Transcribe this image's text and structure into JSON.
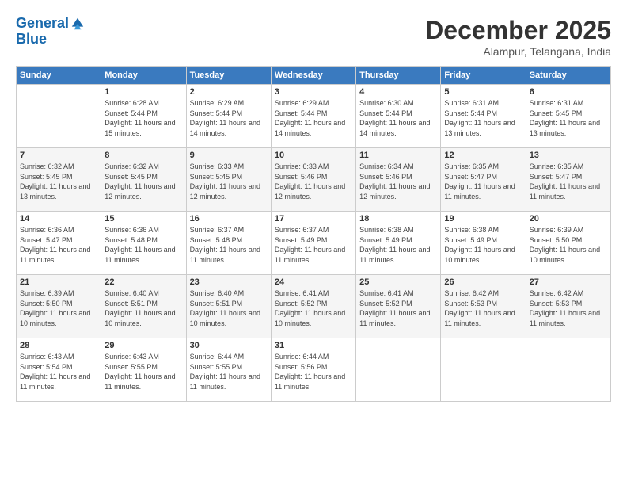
{
  "logo": {
    "line1": "General",
    "line2": "Blue"
  },
  "title": "December 2025",
  "location": "Alampur, Telangana, India",
  "headers": [
    "Sunday",
    "Monday",
    "Tuesday",
    "Wednesday",
    "Thursday",
    "Friday",
    "Saturday"
  ],
  "weeks": [
    [
      {
        "day": "",
        "sunrise": "",
        "sunset": "",
        "daylight": ""
      },
      {
        "day": "1",
        "sunrise": "Sunrise: 6:28 AM",
        "sunset": "Sunset: 5:44 PM",
        "daylight": "Daylight: 11 hours and 15 minutes."
      },
      {
        "day": "2",
        "sunrise": "Sunrise: 6:29 AM",
        "sunset": "Sunset: 5:44 PM",
        "daylight": "Daylight: 11 hours and 14 minutes."
      },
      {
        "day": "3",
        "sunrise": "Sunrise: 6:29 AM",
        "sunset": "Sunset: 5:44 PM",
        "daylight": "Daylight: 11 hours and 14 minutes."
      },
      {
        "day": "4",
        "sunrise": "Sunrise: 6:30 AM",
        "sunset": "Sunset: 5:44 PM",
        "daylight": "Daylight: 11 hours and 14 minutes."
      },
      {
        "day": "5",
        "sunrise": "Sunrise: 6:31 AM",
        "sunset": "Sunset: 5:44 PM",
        "daylight": "Daylight: 11 hours and 13 minutes."
      },
      {
        "day": "6",
        "sunrise": "Sunrise: 6:31 AM",
        "sunset": "Sunset: 5:45 PM",
        "daylight": "Daylight: 11 hours and 13 minutes."
      }
    ],
    [
      {
        "day": "7",
        "sunrise": "Sunrise: 6:32 AM",
        "sunset": "Sunset: 5:45 PM",
        "daylight": "Daylight: 11 hours and 13 minutes."
      },
      {
        "day": "8",
        "sunrise": "Sunrise: 6:32 AM",
        "sunset": "Sunset: 5:45 PM",
        "daylight": "Daylight: 11 hours and 12 minutes."
      },
      {
        "day": "9",
        "sunrise": "Sunrise: 6:33 AM",
        "sunset": "Sunset: 5:45 PM",
        "daylight": "Daylight: 11 hours and 12 minutes."
      },
      {
        "day": "10",
        "sunrise": "Sunrise: 6:33 AM",
        "sunset": "Sunset: 5:46 PM",
        "daylight": "Daylight: 11 hours and 12 minutes."
      },
      {
        "day": "11",
        "sunrise": "Sunrise: 6:34 AM",
        "sunset": "Sunset: 5:46 PM",
        "daylight": "Daylight: 11 hours and 12 minutes."
      },
      {
        "day": "12",
        "sunrise": "Sunrise: 6:35 AM",
        "sunset": "Sunset: 5:47 PM",
        "daylight": "Daylight: 11 hours and 11 minutes."
      },
      {
        "day": "13",
        "sunrise": "Sunrise: 6:35 AM",
        "sunset": "Sunset: 5:47 PM",
        "daylight": "Daylight: 11 hours and 11 minutes."
      }
    ],
    [
      {
        "day": "14",
        "sunrise": "Sunrise: 6:36 AM",
        "sunset": "Sunset: 5:47 PM",
        "daylight": "Daylight: 11 hours and 11 minutes."
      },
      {
        "day": "15",
        "sunrise": "Sunrise: 6:36 AM",
        "sunset": "Sunset: 5:48 PM",
        "daylight": "Daylight: 11 hours and 11 minutes."
      },
      {
        "day": "16",
        "sunrise": "Sunrise: 6:37 AM",
        "sunset": "Sunset: 5:48 PM",
        "daylight": "Daylight: 11 hours and 11 minutes."
      },
      {
        "day": "17",
        "sunrise": "Sunrise: 6:37 AM",
        "sunset": "Sunset: 5:49 PM",
        "daylight": "Daylight: 11 hours and 11 minutes."
      },
      {
        "day": "18",
        "sunrise": "Sunrise: 6:38 AM",
        "sunset": "Sunset: 5:49 PM",
        "daylight": "Daylight: 11 hours and 11 minutes."
      },
      {
        "day": "19",
        "sunrise": "Sunrise: 6:38 AM",
        "sunset": "Sunset: 5:49 PM",
        "daylight": "Daylight: 11 hours and 10 minutes."
      },
      {
        "day": "20",
        "sunrise": "Sunrise: 6:39 AM",
        "sunset": "Sunset: 5:50 PM",
        "daylight": "Daylight: 11 hours and 10 minutes."
      }
    ],
    [
      {
        "day": "21",
        "sunrise": "Sunrise: 6:39 AM",
        "sunset": "Sunset: 5:50 PM",
        "daylight": "Daylight: 11 hours and 10 minutes."
      },
      {
        "day": "22",
        "sunrise": "Sunrise: 6:40 AM",
        "sunset": "Sunset: 5:51 PM",
        "daylight": "Daylight: 11 hours and 10 minutes."
      },
      {
        "day": "23",
        "sunrise": "Sunrise: 6:40 AM",
        "sunset": "Sunset: 5:51 PM",
        "daylight": "Daylight: 11 hours and 10 minutes."
      },
      {
        "day": "24",
        "sunrise": "Sunrise: 6:41 AM",
        "sunset": "Sunset: 5:52 PM",
        "daylight": "Daylight: 11 hours and 10 minutes."
      },
      {
        "day": "25",
        "sunrise": "Sunrise: 6:41 AM",
        "sunset": "Sunset: 5:52 PM",
        "daylight": "Daylight: 11 hours and 11 minutes."
      },
      {
        "day": "26",
        "sunrise": "Sunrise: 6:42 AM",
        "sunset": "Sunset: 5:53 PM",
        "daylight": "Daylight: 11 hours and 11 minutes."
      },
      {
        "day": "27",
        "sunrise": "Sunrise: 6:42 AM",
        "sunset": "Sunset: 5:53 PM",
        "daylight": "Daylight: 11 hours and 11 minutes."
      }
    ],
    [
      {
        "day": "28",
        "sunrise": "Sunrise: 6:43 AM",
        "sunset": "Sunset: 5:54 PM",
        "daylight": "Daylight: 11 hours and 11 minutes."
      },
      {
        "day": "29",
        "sunrise": "Sunrise: 6:43 AM",
        "sunset": "Sunset: 5:55 PM",
        "daylight": "Daylight: 11 hours and 11 minutes."
      },
      {
        "day": "30",
        "sunrise": "Sunrise: 6:44 AM",
        "sunset": "Sunset: 5:55 PM",
        "daylight": "Daylight: 11 hours and 11 minutes."
      },
      {
        "day": "31",
        "sunrise": "Sunrise: 6:44 AM",
        "sunset": "Sunset: 5:56 PM",
        "daylight": "Daylight: 11 hours and 11 minutes."
      },
      {
        "day": "",
        "sunrise": "",
        "sunset": "",
        "daylight": ""
      },
      {
        "day": "",
        "sunrise": "",
        "sunset": "",
        "daylight": ""
      },
      {
        "day": "",
        "sunrise": "",
        "sunset": "",
        "daylight": ""
      }
    ]
  ]
}
